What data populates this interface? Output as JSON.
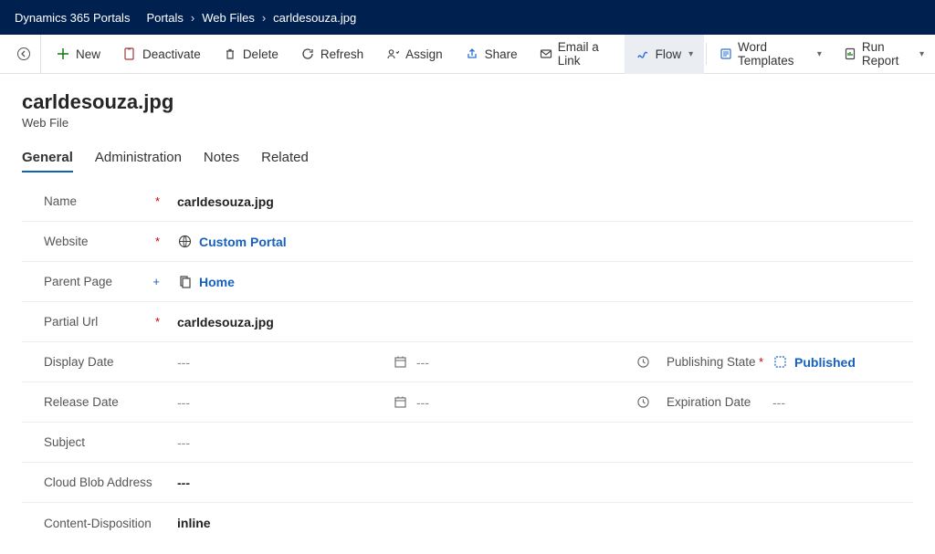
{
  "nav": {
    "app_name": "Dynamics 365 Portals",
    "breadcrumbs": [
      "Portals",
      "Web Files",
      "carldesouza.jpg"
    ]
  },
  "commands": {
    "new": "New",
    "deactivate": "Deactivate",
    "delete": "Delete",
    "refresh": "Refresh",
    "assign": "Assign",
    "share": "Share",
    "email_link": "Email a Link",
    "flow": "Flow",
    "word_templates": "Word Templates",
    "run_report": "Run Report"
  },
  "header": {
    "title": "carldesouza.jpg",
    "entity": "Web File"
  },
  "tabs": {
    "general": "General",
    "administration": "Administration",
    "notes": "Notes",
    "related": "Related"
  },
  "fields": {
    "name_label": "Name",
    "name_value": "carldesouza.jpg",
    "website_label": "Website",
    "website_value": "Custom Portal",
    "parent_label": "Parent Page",
    "parent_value": "Home",
    "partial_label": "Partial Url",
    "partial_value": "carldesouza.jpg",
    "display_date_label": "Display Date",
    "display_date_date": "---",
    "display_date_time": "---",
    "publishing_state_label": "Publishing State",
    "publishing_state_value": "Published",
    "release_date_label": "Release Date",
    "release_date_date": "---",
    "release_date_time": "---",
    "expiration_label": "Expiration Date",
    "expiration_value": "---",
    "subject_label": "Subject",
    "subject_value": "---",
    "cloud_label": "Cloud Blob Address",
    "cloud_value": "---",
    "disposition_label": "Content-Disposition",
    "disposition_value": "inline"
  }
}
